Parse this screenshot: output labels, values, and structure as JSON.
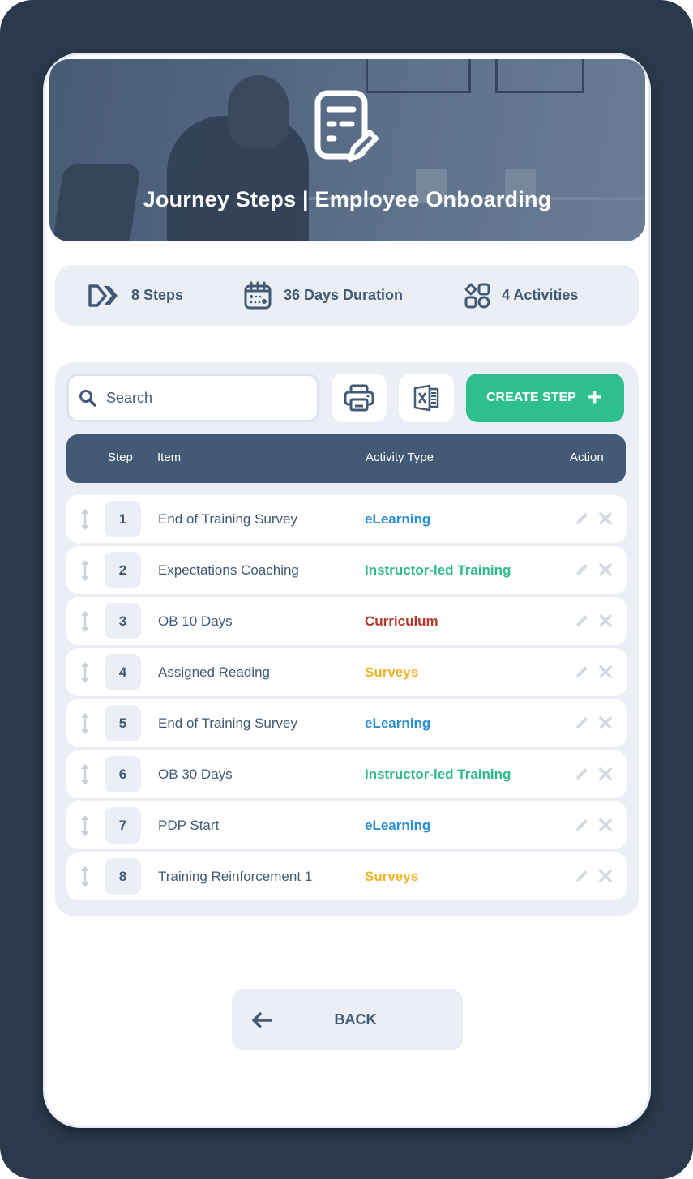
{
  "hero": {
    "title": "Journey Steps | Employee Onboarding",
    "icon": "document-edit-icon"
  },
  "stats": {
    "steps": {
      "label": "8 Steps",
      "icon": "double-chevron-right-icon"
    },
    "duration": {
      "label": "36 Days Duration",
      "icon": "calendar-icon"
    },
    "activities": {
      "label": "4 Activities",
      "icon": "shapes-grid-icon"
    }
  },
  "toolbar": {
    "search_placeholder": "Search",
    "search_value": "",
    "print_icon": "printer-icon",
    "excel_icon": "excel-export-icon",
    "create_label": "CREATE STEP",
    "create_icon": "plus-icon"
  },
  "table": {
    "headers": {
      "step": "Step",
      "item": "Item",
      "activity_type": "Activity Type",
      "action": "Action"
    },
    "rows": [
      {
        "step": "1",
        "item": "End of Training Survey",
        "activity_type": "eLearning"
      },
      {
        "step": "2",
        "item": "Expectations Coaching",
        "activity_type": "Instructor-led Training"
      },
      {
        "step": "3",
        "item": "OB 10 Days",
        "activity_type": "Curriculum"
      },
      {
        "step": "4",
        "item": "Assigned Reading",
        "activity_type": "Surveys"
      },
      {
        "step": "5",
        "item": "End of Training Survey",
        "activity_type": "eLearning"
      },
      {
        "step": "6",
        "item": "OB 30 Days",
        "activity_type": "Instructor-led Training"
      },
      {
        "step": "7",
        "item": "PDP Start",
        "activity_type": "eLearning"
      },
      {
        "step": "8",
        "item": "Training Reinforcement 1",
        "activity_type": "Surveys"
      }
    ]
  },
  "activity_colors": {
    "eLearning": "#2b8fd1",
    "Instructor-led Training": "#2dbb88",
    "Curriculum": "#b33a2a",
    "Surveys": "#f0b429"
  },
  "colors": {
    "primary": "#425a75",
    "accent_green": "#2dc08e",
    "surface": "#ebeff5",
    "background": "#2a394b"
  },
  "footer": {
    "back_label": "BACK",
    "back_icon": "arrow-left-icon"
  }
}
